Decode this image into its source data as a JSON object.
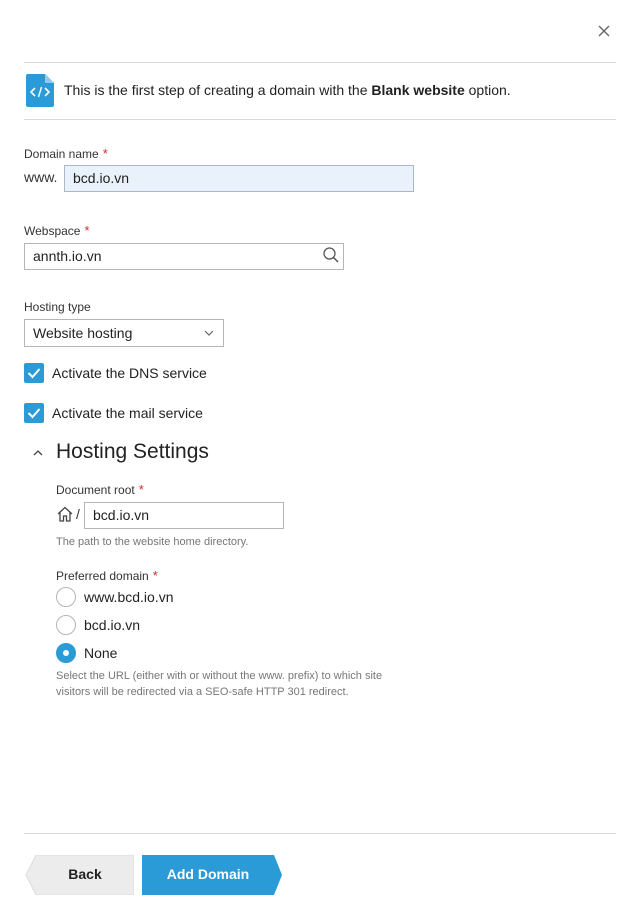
{
  "dialog": {
    "close_icon": "close-icon",
    "intro": {
      "icon": "code-file-icon",
      "text_before": "This is the first step of creating a domain with the ",
      "text_bold": "Blank website",
      "text_after": " option."
    }
  },
  "form": {
    "domain_name": {
      "label": "Domain name",
      "required_mark": "*",
      "prefix": "www.",
      "value": "bcd.io.vn"
    },
    "webspace": {
      "label": "Webspace",
      "required_mark": "*",
      "value": "annth.io.vn",
      "icon": "search-icon"
    },
    "hosting_type": {
      "label": "Hosting type",
      "selected": "Website hosting"
    },
    "dns_service": {
      "label": "Activate the DNS service",
      "checked": true
    },
    "mail_service": {
      "label": "Activate the mail service",
      "checked": true
    }
  },
  "hosting_settings": {
    "title": "Hosting Settings",
    "expanded": true,
    "document_root": {
      "label": "Document root",
      "required_mark": "*",
      "home_icon": "home-icon",
      "separator": "/",
      "value": "bcd.io.vn",
      "hint": "The path to the website home directory."
    },
    "preferred_domain": {
      "label": "Preferred domain",
      "required_mark": "*",
      "options": [
        {
          "label": "www.bcd.io.vn",
          "checked": false
        },
        {
          "label": "bcd.io.vn",
          "checked": false
        },
        {
          "label": "None",
          "checked": true
        }
      ],
      "hint_line1": "Select the URL (either with or without the www. prefix) to which site",
      "hint_line2": "visitors will be redirected via a SEO-safe HTTP 301 redirect."
    }
  },
  "footer": {
    "back_label": "Back",
    "add_label": "Add Domain"
  },
  "colors": {
    "accent": "#2a9bd6",
    "required": "#d02b2b",
    "focused_input_bg": "#e9f1fb",
    "back_button_bg": "#ececec"
  }
}
